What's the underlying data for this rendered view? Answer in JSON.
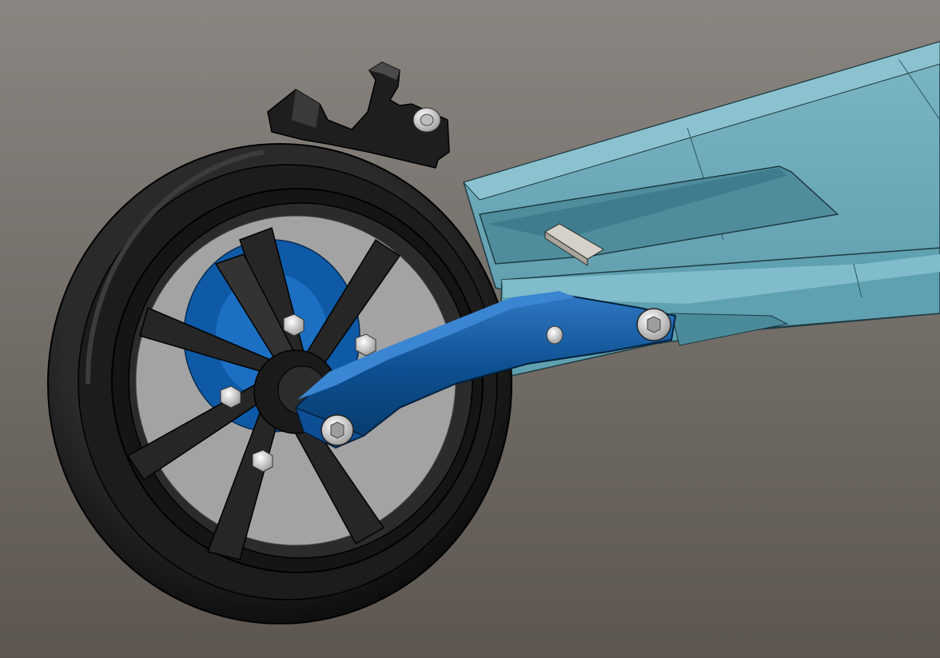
{
  "viewport": {
    "background_top": "#898580",
    "background_bottom": "#5d5650"
  },
  "model": {
    "deck_color": "#66a5b5",
    "deck_light": "#8cc0cd",
    "deck_dark": "#3f7f90",
    "swingarm_color": "#0a4c8c",
    "swingarm_light": "#2e77c0",
    "tire_color": "#1b1b1b",
    "rim_color": "#232323",
    "disc_color": "#9e9e9e",
    "hardware_color": "#d8d8d8",
    "icons": [
      "scooter-deck",
      "rear-wheel",
      "swing-arm",
      "brake-disc",
      "brake-caliper",
      "socket-head-bolt",
      "hex-nut"
    ]
  }
}
